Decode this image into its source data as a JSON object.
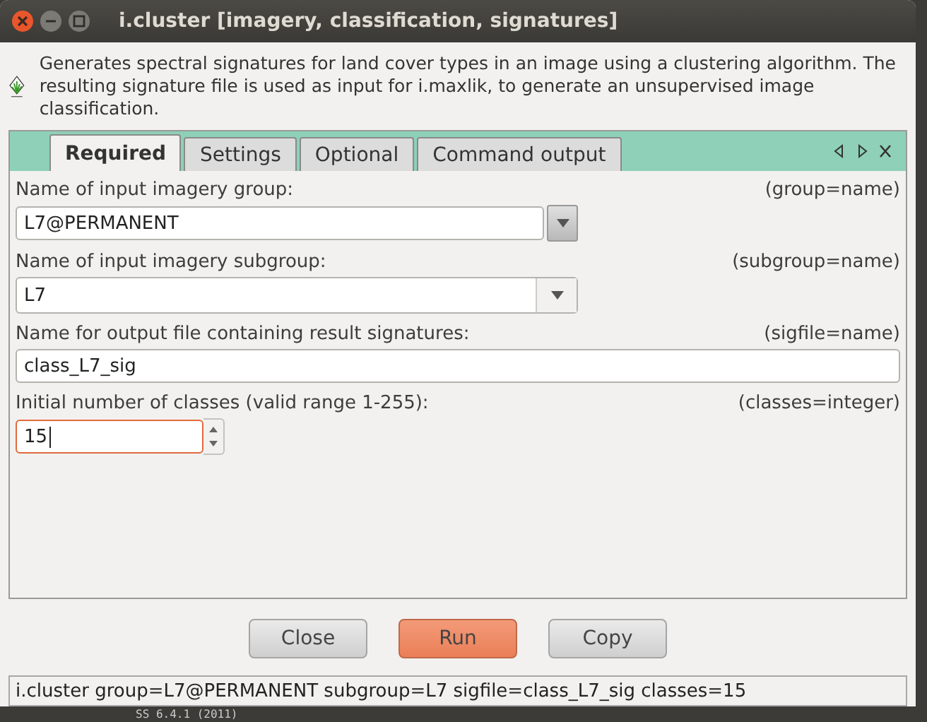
{
  "window": {
    "title": "i.cluster [imagery, classification, signatures]"
  },
  "description": "Generates spectral signatures for land cover types in an image using a clustering algorithm. The resulting signature file is used as input for i.maxlik, to generate an unsupervised image classification.",
  "tabs": [
    {
      "label": "Required",
      "selected": true
    },
    {
      "label": "Settings",
      "selected": false
    },
    {
      "label": "Optional",
      "selected": false
    },
    {
      "label": "Command output",
      "selected": false
    }
  ],
  "fields": [
    {
      "kind": "combo-button",
      "label": "Name of input imagery group:",
      "param": "(group=name)",
      "value": "L7@PERMANENT",
      "focused": false
    },
    {
      "kind": "combo",
      "label": "Name of input imagery subgroup:",
      "param": "(subgroup=name)",
      "value": "L7",
      "focused": false
    },
    {
      "kind": "text",
      "label": "Name for output file containing result signatures:",
      "param": "(sigfile=name)",
      "value": "class_L7_sig",
      "focused": false
    },
    {
      "kind": "spin",
      "label": "Initial number of classes (valid range 1-255):",
      "param": "(classes=integer)",
      "value": "15",
      "focused": true
    }
  ],
  "buttons": [
    {
      "label": "Close",
      "kind": "normal"
    },
    {
      "label": "Run",
      "kind": "default"
    },
    {
      "label": "Copy",
      "kind": "normal"
    }
  ],
  "status_bar": "i.cluster group=L7@PERMANENT subgroup=L7 sigfile=class_L7_sig classes=15",
  "background_terminal": "SS 6.4.1 (2011)"
}
